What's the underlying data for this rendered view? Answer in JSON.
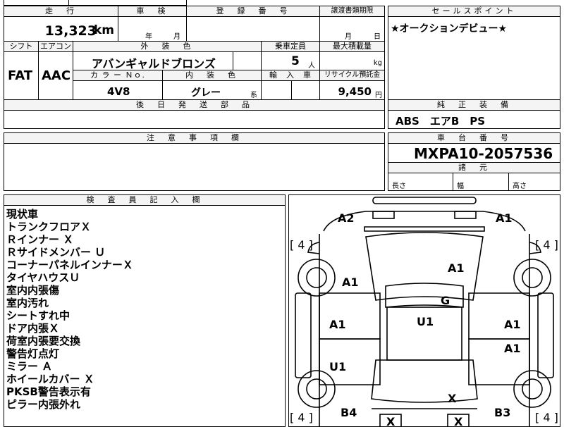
{
  "top": {
    "mileage_header": "走　行",
    "mileage_value": "13,323",
    "mileage_unit": "km",
    "inspection_header": "車　検",
    "inspection_year": "年",
    "inspection_month": "月",
    "registration_header": "登　録　番　号",
    "transfer_header": "譲渡書類期限",
    "transfer_month": "月",
    "transfer_day": "日",
    "sales_header": "セールスポイント",
    "sales_text": "★オークションデビュー★"
  },
  "row2": {
    "shift_header": "シフト",
    "aircon_header": "エアコン",
    "exterior_header": "外　装　色",
    "capacity_header": "乗車定員",
    "maxload_header": "最大積載量",
    "shift_value": "FAT",
    "aircon_value": "AAC",
    "exterior_value": "アバンギャルドブロンズ",
    "capacity_value": "5",
    "capacity_unit": "人",
    "maxload_unit": "kg",
    "colorno_header": "カ ラ ー Ｎｏ.",
    "interior_header": "内　装　色",
    "import_header": "輸　入　車",
    "recycle_header": "リサイクル預託金",
    "colorno_value": "4V8",
    "interior_value": "グレー",
    "interior_suffix": "系",
    "recycle_value": "9,450",
    "recycle_unit": "円"
  },
  "later_parts_header": "後　日　発　送　部　品",
  "genuine": {
    "header": "純　正　装　備",
    "value": "ABS　エアB　PS"
  },
  "notes_header": "注　意　事　項　欄",
  "chassis": {
    "header": "車　台　番　号",
    "value": "MXPA10-2057536",
    "dims_header": "諸　元",
    "length_label": "長さ",
    "width_label": "幅",
    "height_label": "高さ"
  },
  "inspector": {
    "header": "検　査　員　記　入　欄",
    "lines": [
      "現状車",
      "トランクフロアＸ",
      "Ｒインナー Ｘ",
      "Ｒサイドメンバー Ｕ",
      "コーナーパネルインナーＸ",
      "タイヤハウスＵ",
      "室内内張傷",
      "室内汚れ",
      "シートすれ中",
      "ドア内張Ｘ",
      "荷室内張要交換",
      "警告灯点灯",
      "ミラー Ａ",
      "ホイールカバー Ｘ",
      "PKSB警告表示有",
      "ピラー内張外れ"
    ]
  },
  "diagram": {
    "marks": {
      "a2_top": "A2",
      "a1_top_right": "A1",
      "tire_fl": "[ 4 ]",
      "tire_fr": "[ 4 ]",
      "tire_rl": "[ 4 ]",
      "tire_rr": "[ 4 ]",
      "roof_a1": "A1",
      "left_front_a1": "A1",
      "g": "G",
      "left_door_a1": "A1",
      "u1_center": "U1",
      "right_door_a1": "A1",
      "right_rear_a1": "A1",
      "left_rear_u1": "U1",
      "x_rear": "X",
      "b4": "B4",
      "b3": "B3",
      "x_bottom_left": "X",
      "x_bottom_right": "X"
    }
  }
}
